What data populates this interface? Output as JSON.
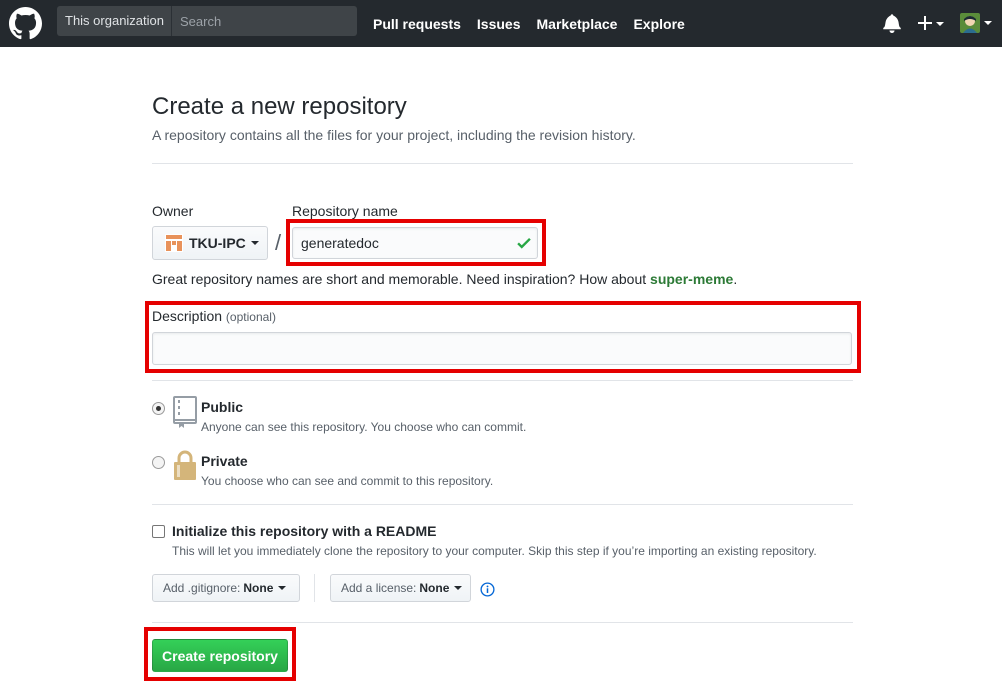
{
  "header": {
    "scope": "This organization",
    "search_placeholder": "Search",
    "nav": [
      "Pull requests",
      "Issues",
      "Marketplace",
      "Explore"
    ],
    "plus_label": "+",
    "icons": [
      "octocat-logo-icon",
      "bell-icon",
      "plus-icon",
      "avatar-icon"
    ]
  },
  "page": {
    "title": "Create a new repository",
    "subtitle": "A repository contains all the files for your project, including the revision history."
  },
  "form": {
    "owner_label": "Owner",
    "owner_value": "TKU-IPC",
    "separator": "/",
    "repo_label": "Repository name",
    "repo_value": "generatedoc",
    "hint_prefix": "Great repository names are short and memorable. Need inspiration? How about ",
    "hint_suggestion": "super-meme",
    "hint_suffix": ".",
    "description_label": "Description",
    "description_optional": "(optional)",
    "description_value": "",
    "visibility": [
      {
        "title": "Public",
        "note": "Anyone can see this repository. You choose who can commit.",
        "selected": true
      },
      {
        "title": "Private",
        "note": "You choose who can see and commit to this repository.",
        "selected": false
      }
    ],
    "init_label": "Initialize this repository with a README",
    "init_note": "This will let you immediately clone the repository to your computer. Skip this step if you’re importing an existing repository.",
    "init_checked": false,
    "gitignore_label": "Add .gitignore:",
    "gitignore_value": "None",
    "license_label": "Add a license:",
    "license_value": "None",
    "submit_label": "Create repository"
  },
  "colors": {
    "header_bg": "#24292e",
    "highlight": "#e50000",
    "primary_button": "#28a745"
  }
}
